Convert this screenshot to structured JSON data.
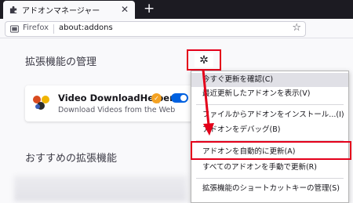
{
  "tab": {
    "title": "アドオンマネージャー",
    "close_glyph": "✕",
    "new_tab_glyph": "+"
  },
  "navbar": {
    "identity": "Firefox",
    "url": "about:addons",
    "star_glyph": "☆"
  },
  "page": {
    "heading": "拡張機能の管理",
    "gear_glyph": "✲",
    "recommended_heading": "おすすめの拡張機能"
  },
  "addon": {
    "name": "Video DownloadHelper",
    "description": "Download Videos from the Web",
    "badge_glyph": "✓",
    "enabled": true
  },
  "menu": {
    "items": [
      "今すぐ更新を確認(C)",
      "最近更新したアドオンを表示(V)",
      "ファイルからアドオンをインストール...(I)",
      "アドオンをデバッグ(B)",
      "アドオンを自動的に更新(A)",
      "すべてのアドオンを手動で更新(R)",
      "拡張機能のショートカットキーの管理(S)"
    ]
  },
  "colors": {
    "annotation_red": "#e4001a",
    "toggle_blue": "#0061e0",
    "badge_orange": "#f4a223"
  }
}
